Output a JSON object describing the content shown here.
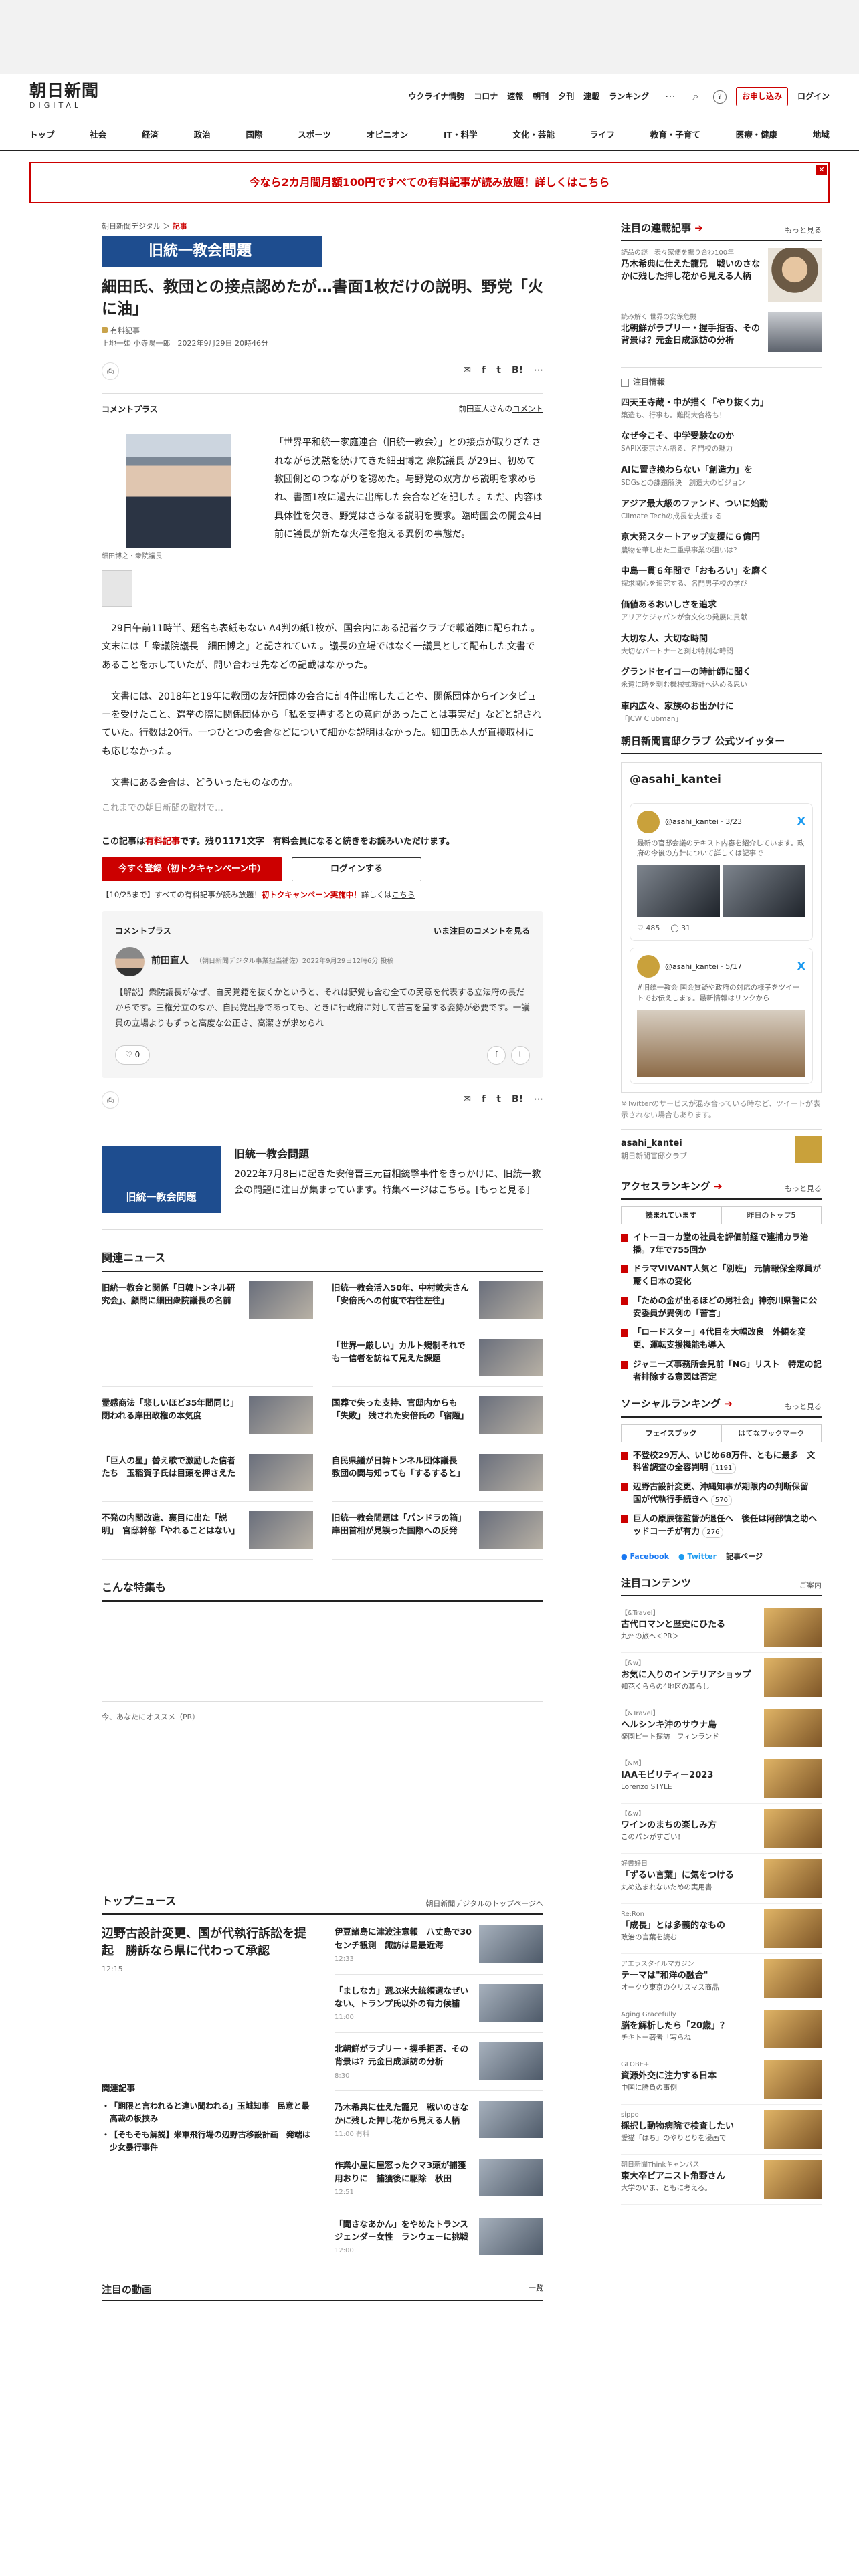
{
  "header": {
    "logo": {
      "main": "朝日新聞",
      "sub": "DIGITAL"
    },
    "nav": [
      "ウクライナ情勢",
      "コロナ",
      "速報",
      "朝刊",
      "夕刊",
      "連載",
      "ランキング"
    ],
    "subscribe": "お申し込み",
    "login": "ログイン"
  },
  "globalnav": [
    "トップ",
    "社会",
    "経済",
    "政治",
    "国際",
    "スポーツ",
    "オピニオン",
    "IT・科学",
    "文化・芸能",
    "ライフ",
    "教育・子育て",
    "医療・健康",
    "地域"
  ],
  "banner": "今なら2カ月間月額100円ですべての有料記事が読み放題！詳しくはこちら",
  "article": {
    "breadcrumb": [
      "朝日新聞デジタル",
      "記事"
    ],
    "series": "旧統一教会問題",
    "title": "細田氏、教団との接点認めたが…書面1枚だけの説明、野党「火に油」",
    "paid": "有料記事",
    "byline": "上地一姫 小寺陽一郎　2022年9月29日 20時46分",
    "share": {
      "hatena": "B!",
      "list": "list",
      "count": "1"
    },
    "commentplus": {
      "label": "コメントプラス",
      "right": "前田直人さんの",
      "link": "コメント"
    },
    "caption": "細田博之・衆院議長",
    "lead": "「世界平和統一家庭連合（旧統一教会）」との接点が取りざたされながら沈黙を続けてきた細田博之 衆院議長 が29日、初めて教団側とのつながりを認めた。与野党の双方から説明を求められ、書面1枚に過去に出席した会合などを記した。ただ、内容は具体性を欠き、野党はさらなる説明を要求。臨時国会の開会4日前に議長が新たな火種を抱える異例の事態だ。",
    "p1": "29日午前11時半、題名も表紙もない A4判の紙1枚が、国会内にある記者クラブで報道陣に配られた。文末には「 衆議院議長　細田博之」と記されていた。議長の立場ではなく一議員として配布した文書であることを示していたが、問い合わせ先などの記載はなかった。",
    "p2": "文書には、2018年と19年に教団の友好団体の会合に計4件出席したことや、関係団体からインタビューを受けたこと、選挙の際に関係団体から「私を支持するとの意向があったことは事実だ」などと記されていた。行数は20行。一つひとつの会合などについて細かな説明はなかった。細田氏本人が直接取材にも応じなかった。",
    "p3": "文書にある会合は、どういったものなのか。",
    "fade": "これまでの朝日新聞の取材で…"
  },
  "paywall": {
    "a": "この記事は",
    "b": "有料記事",
    "c": "です。残り1171文字　有料会員になると続きをお読みいただけます。",
    "register": "今すぐ登録（初トクキャンペーン中）",
    "login": "ログインする",
    "campaign": {
      "a": "【10/25まで】すべての有料記事が読み放題！",
      "b": "初トクキャンペーン実施中！",
      "c": "詳しくは",
      "d": "こちら"
    }
  },
  "comment": {
    "label": "コメントプラス",
    "see": "いま注目のコメントを見る",
    "name": "前田直人",
    "meta": "（朝日新聞デジタル事業担当補佐）2022年9月29日12時6分 投稿",
    "text": "【解説】衆院議長がなぜ、自民党籍を抜くかというと、それは野党も含む全ての民意を代表する立法府の長だからです。三権分立のなか、自民党出身であっても、ときに行政府に対して苦言を呈する姿勢が必要です。一議員の立場よりもずっと高度な公正さ、高潔さが求められ",
    "likes": "0",
    "fb": "f",
    "tw": "t"
  },
  "seriesbox": {
    "img": "旧統一教会問題",
    "title": "旧統一教会問題",
    "desc": "2022年7月8日に起きた安倍晋三元首相銃撃事件をきっかけに、旧統一教会の問題に注目が集まっています。特集ページはこちら。[もっと見る]"
  },
  "related": {
    "heading": "関連ニュース",
    "items": [
      "旧統一教会と関係「日韓トンネル研究会」、顧問に細田衆院議長の名前",
      "旧統一教会活入50年、中村敦夫さん「安倍氏への付度で右往左往」",
      "",
      "「世界一厳しい」カルト規制それでも一信者を訪ねて見えた課題",
      "霊感商法「悲しいほど35年間同じ」　閉われる岸田政権の本気度",
      "国葬で失った支持、官邸内からも「失敗」 残された安倍氏の「宿題」",
      "「巨人の星」替え歌で激励した信者たち　玉稲賀子氏は目頭を押さえた",
      "自民県議が日韓トンネル団体議長　教団の関与知っても「するすると」",
      "不発の内閣改造、裏目に出た「説明」　官邸幹部「やれることはない」",
      "旧統一教会問題は「パンドラの箱」　岸田首相が見誤った国際への反発"
    ]
  },
  "special": {
    "heading": "こんな特集も",
    "pr": "今、あなたにオススメ（PR）"
  },
  "topnews": {
    "heading": "トップニュース",
    "more": "朝日新聞デジタルのトップページへ",
    "main": "辺野古設計変更、国が代執行訴訟を提起　勝訴なら県に代わって承認",
    "maintime": "12:15",
    "relheading": "関連記事",
    "rel": [
      "「期限と言われると違い聞われる」玉城知事　民意と最高裁の板挟み",
      "【そもそも解説】米軍飛行場の辺野古移設計画　発端は少女暴行事件"
    ],
    "right": [
      {
        "t": "伊豆諸島に津波注意報　八丈島で30センチ観測　諏訪は島最近海",
        "tm": "12:33"
      },
      {
        "t": "「ましなカ」選ぶ米大統領選なぜいない、トランプ氏以外の有力候補",
        "tm": "11:00"
      },
      {
        "t": "北朝鮮がラブリー・握手拒否、その背景は？元金日成派訪の分析",
        "tm": "8:30"
      },
      {
        "t": "乃木希典に仕えた籠兄　戦いのさなかに残した押し花から見える人柄",
        "tm": "11:00 有料"
      },
      {
        "t": "作業小屋に屋窓ったクマ3頭が捕獲用おりに　捕獲後に駆除　秋田",
        "tm": "12:51"
      },
      {
        "t": "「聞さなあかん」をやめたトランスジェンダー女性　ランウェーに挑戦",
        "tm": "12:00"
      }
    ]
  },
  "videos": {
    "heading": "注目の動画",
    "more": "一覧"
  },
  "side": {
    "serial": {
      "heading": "注目の連載記事",
      "more": "もっと見る",
      "items": [
        {
          "label": "読品の謎　表々家便を振り合わ100年",
          "t": "乃木希典に仕えた籠兄　戦いのさなかに残した押し花から見える人柄"
        },
        {
          "label": "読み解く 世界の安保危機",
          "t": "北朝鮮がラブリー・握手拒否、その背景は？元金日成派訪の分析"
        }
      ]
    },
    "info": "注目情報",
    "ads": [
      {
        "a": "四天王寺蔵・中が描く「やり抜く力」",
        "b": "築造も、行事も。難間大合格も！"
      },
      {
        "a": "なぜ今こそ、中学受験なのか",
        "b": "SAPIX東京さん語る、名門校の魅力"
      },
      {
        "a": "AIに置き換わらない「創造力」を",
        "b": "SDGsとの課題解決　創造大のビジョン"
      },
      {
        "a": "アジア最大級のファンド、ついに始動",
        "b": "Climate Techの成長を支援する"
      },
      {
        "a": "京大発スタートアップ支援に６億円",
        "b": "農物を華し出た三重県事業の狙いは？"
      },
      {
        "a": "中島一貫６年間で「おもろい」を磨く",
        "b": "探求関心を追究する、名門男子校の学び"
      },
      {
        "a": "価値あるおいしさを追求",
        "b": "アリアケジャパンが食文化の発展に貢献"
      },
      {
        "a": "大切な人、大切な時間",
        "b": "大切なパートナーと刻む特別な時間"
      },
      {
        "a": "グランドセイコーの時計師に聞く",
        "b": "永遠に時を刻む機械式時計へ込める思い"
      },
      {
        "a": "車内広々、家族のお出かけに",
        "b": "「JCW Clubman」"
      }
    ],
    "twitter": {
      "heading": "朝日新聞官邸クラブ 公式ツイッター",
      "account": "@asahi_kantei",
      "t1": {
        "h": "@asahi_kantei · 3/23",
        "text": "最新の官邸会議のテキスト内容を紹介しています。政府の今後の方針について詳しくは記事で",
        "like": "485",
        "reply": "31"
      },
      "t2": {
        "h": "@asahi_kantei · 5/17",
        "text": "#旧統一教会 国会質疑や政府の対応の様子をツイートでお伝えします。最新情報はリンクから"
      },
      "note": "※Twitterのサービスが混み合っている時など、ツイートが表示されない場合もあります。",
      "foot": "asahi_kantei",
      "footsub": "朝日新聞官邸クラブ"
    },
    "ranking": {
      "heading": "アクセスランキング",
      "more": "もっと見る",
      "tab1": "読まれています",
      "tab2": "昨日のトップ5",
      "items": [
        "イトーヨーカ堂の社員を評価前経で連捕カラ治播。7年で755回か",
        "ドラマVIVANT人気と「別班」 元情報保全隊員が驚く日本の変化",
        "「ための金が出るほどの男社会」神奈川県警に公安委員が異例の「苦言」",
        "「ロードスター」4代目を大幅改良　外観を変更、運転支援機能も導入",
        "ジャニーズ事務所会見前「NG」リスト　特定の記者排除する意図は否定"
      ]
    },
    "social": {
      "heading": "ソーシャルランキング",
      "more": "もっと見る",
      "tab1": "フェイスブック",
      "tab2": "はてなブックマーク",
      "items": [
        {
          "t": "不登校29万人、いじめ68万件、ともに最多　文科省調査の全容判明",
          "c": "1191"
        },
        {
          "t": "辺野古設計変更、沖縄知事が期限内の判断保留　国が代執行手続きへ",
          "c": "570"
        },
        {
          "t": "巨人の原辰徳監督が退任へ　後任は阿部慎之助ヘッドコーチが有力",
          "c": "276"
        }
      ],
      "fb": "Facebook",
      "tw": "Twitter",
      "more2": "記事ページ"
    },
    "contents": {
      "heading": "注目コンテンツ",
      "more": "ご案内",
      "items": [
        {
          "l": "【&Travel】",
          "t": "古代ロマンと歴史にひたる",
          "s": "九州の旅へ＜PR＞"
        },
        {
          "l": "【&w】",
          "t": "お気に入りのインテリアショップ",
          "s": "知花くららの4地区の暮らし"
        },
        {
          "l": "【&Travel】",
          "t": "ヘルシンキ沖のサウナ島",
          "s": "楽園ピート探訪　フィンランド"
        },
        {
          "l": "【&M】",
          "t": "IAAモビリティー2023",
          "s": "Lorenzo STYLE"
        },
        {
          "l": "【&w】",
          "t": "ワインのまちの楽しみ方",
          "s": "このパンがすごい！"
        },
        {
          "l": "好書好日",
          "t": "「ずるい言葉」に気をつける",
          "s": "丸め込まれないための実用書"
        },
        {
          "l": "Re:Ron",
          "t": "「成長」とは多義的なもの",
          "s": "政治の言葉を読む"
        },
        {
          "l": "アエラスタイルマガジン",
          "t": "テーマは\"和洋の融合\"",
          "s": "オークウ東京のクリスマス商品"
        },
        {
          "l": "Aging Gracefully",
          "t": "脳を解析したら「20歳」？",
          "s": "チキトー著者「写らね"
        },
        {
          "l": "GLOBE+",
          "t": "資源外交に注力する日本",
          "s": "中国に勝負の事例"
        },
        {
          "l": "sippo",
          "t": "採択し動物病院で検査したい",
          "s": "愛猫「はち」のやりとりを漫画で"
        },
        {
          "l": "朝日新聞Thinkキャンパス",
          "t": "東大卒ピアニスト角野さん",
          "s": "大学のいま、ともに考える。"
        }
      ]
    }
  }
}
